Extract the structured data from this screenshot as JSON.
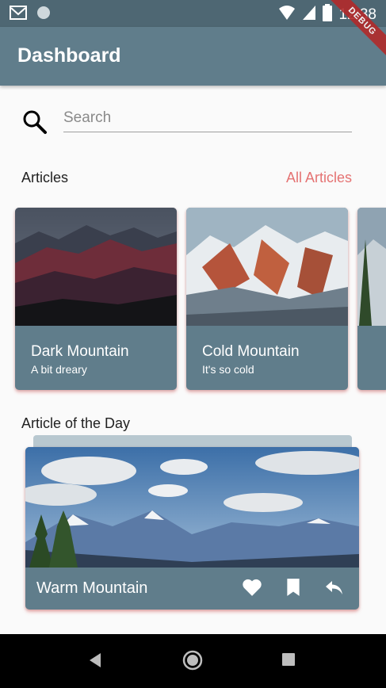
{
  "status_bar": {
    "time": "12:38",
    "debug_banner": "DEBUG"
  },
  "app_bar": {
    "title": "Dashboard"
  },
  "search": {
    "placeholder": "Search",
    "value": ""
  },
  "articles": {
    "label": "Articles",
    "all_link": "All Articles",
    "cards": [
      {
        "title": "Dark Mountain",
        "subtitle": "A bit dreary"
      },
      {
        "title": "Cold Mountain",
        "subtitle": "It's so cold"
      }
    ]
  },
  "article_of_day": {
    "label": "Article of the Day",
    "title": "Warm Mountain",
    "actions": [
      "heart-icon",
      "bookmark-icon",
      "reply-icon"
    ]
  },
  "nav_bar": {
    "buttons": [
      "back-icon",
      "home-icon",
      "recents-icon"
    ]
  },
  "colors": {
    "primary": "#607d8b",
    "accent": "#e57373",
    "status_bar": "#4e6773"
  }
}
